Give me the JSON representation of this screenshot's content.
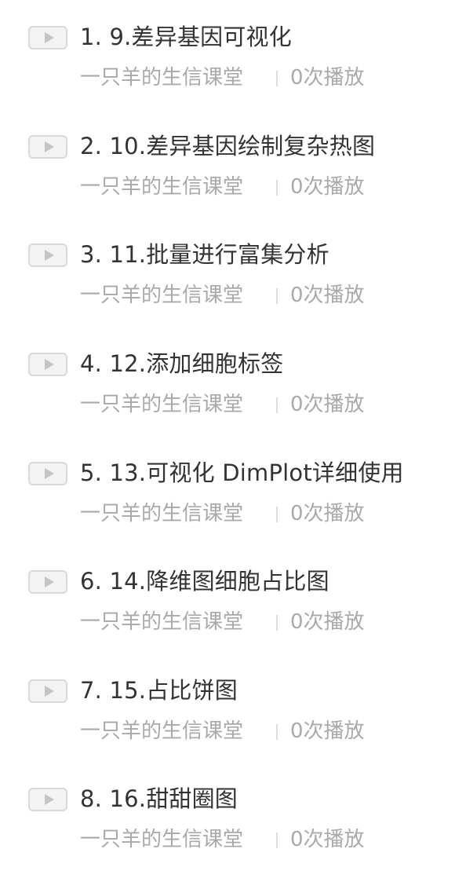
{
  "course_list": {
    "items": [
      {
        "title": "1. 9.差异基因可视化",
        "author": "一只羊的生信课堂",
        "plays": "0次播放",
        "icon": "play-icon"
      },
      {
        "title": "2. 10.差异基因绘制复杂热图",
        "author": "一只羊的生信课堂",
        "plays": "0次播放",
        "icon": "play-icon"
      },
      {
        "title": "3. 11.批量进行富集分析",
        "author": "一只羊的生信课堂",
        "plays": "0次播放",
        "icon": "play-icon"
      },
      {
        "title": "4. 12.添加细胞标签",
        "author": "一只羊的生信课堂",
        "plays": "0次播放",
        "icon": "play-icon"
      },
      {
        "title": "5. 13.可视化 DimPlot详细使用",
        "author": "一只羊的生信课堂",
        "plays": "0次播放",
        "icon": "play-icon"
      },
      {
        "title": "6. 14.降维图细胞占比图",
        "author": "一只羊的生信课堂",
        "plays": "0次播放",
        "icon": "play-icon"
      },
      {
        "title": "7. 15.占比饼图",
        "author": "一只羊的生信课堂",
        "plays": "0次播放",
        "icon": "play-icon"
      },
      {
        "title": "8. 16.甜甜圈图",
        "author": "一只羊的生信课堂",
        "plays": "0次播放",
        "icon": "play-icon"
      }
    ]
  },
  "colors": {
    "title_text": "#333333",
    "meta_text": "#a9a9a9",
    "play_button_bg": "#f3f3f3",
    "play_button_border": "#d9d9d9",
    "play_icon": "#c4c4c4"
  }
}
